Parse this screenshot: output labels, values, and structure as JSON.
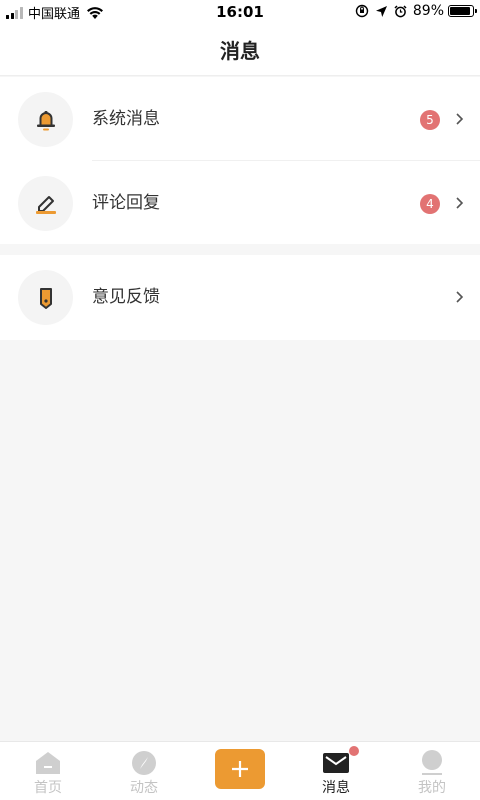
{
  "status_bar": {
    "carrier": "中国联通",
    "time": "16:01",
    "battery_percent": "89%",
    "battery_level": 0.89
  },
  "header": {
    "title": "消息"
  },
  "list": {
    "items": [
      {
        "label": "系统消息",
        "badge": "5",
        "icon": "bell-icon"
      },
      {
        "label": "评论回复",
        "badge": "4",
        "icon": "edit-icon"
      },
      {
        "label": "意见反馈",
        "icon": "feedback-tag-icon"
      }
    ]
  },
  "tab_bar": {
    "tabs": [
      {
        "label": "首页",
        "icon": "home-icon",
        "active": false
      },
      {
        "label": "动态",
        "icon": "compass-icon",
        "active": false
      },
      {
        "icon": "plus-icon",
        "primary": true
      },
      {
        "label": "消息",
        "icon": "mail-icon",
        "active": true,
        "dot": true
      },
      {
        "label": "我的",
        "icon": "user-icon",
        "active": false
      }
    ]
  },
  "colors": {
    "accent": "#ec9a32",
    "badge": "#e27373",
    "page_background": "#f6f6f6",
    "inactive_tab": "#c4c4c4"
  }
}
